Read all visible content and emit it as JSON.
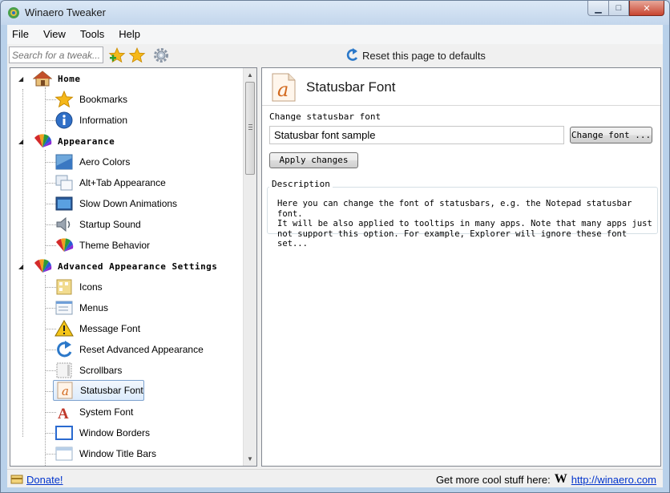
{
  "window": {
    "title": "Winaero Tweaker",
    "controls": {
      "minimize": "▁",
      "maximize": "□",
      "close": "✕"
    }
  },
  "menu": [
    "File",
    "View",
    "Tools",
    "Help"
  ],
  "toolbar": {
    "search_placeholder": "Search for a tweak...",
    "reset_label": "Reset this page to defaults"
  },
  "tree": {
    "home": {
      "label": "Home",
      "items": [
        "Bookmarks",
        "Information"
      ]
    },
    "appearance": {
      "label": "Appearance",
      "items": [
        "Aero Colors",
        "Alt+Tab Appearance",
        "Slow Down Animations",
        "Startup Sound",
        "Theme Behavior"
      ]
    },
    "advanced": {
      "label": "Advanced Appearance Settings",
      "items": [
        "Icons",
        "Menus",
        "Message Font",
        "Reset Advanced Appearance",
        "Scrollbars",
        "Statusbar Font",
        "System Font",
        "Window Borders",
        "Window Title Bars"
      ]
    },
    "selected": "Statusbar Font"
  },
  "content": {
    "title": "Statusbar Font",
    "change_label": "Change statusbar font",
    "sample_text": "Statusbar font sample",
    "change_font_button": "Change font ...",
    "apply_button": "Apply changes",
    "description_label": "Description",
    "description_lines": [
      "Here you can change the font of statusbars, e.g. the Notepad statusbar font.",
      "It will be also applied to tooltips in many apps. Note that many apps just",
      "not support this option. For example, Explorer will ignore these font set..."
    ]
  },
  "status": {
    "donate": "Donate!",
    "cool": "Get more cool stuff here:",
    "url": "http://winaero.com",
    "logo_letter": "W"
  },
  "colors": {
    "accent": "#3366cc",
    "link": "#0033cc",
    "close": "#c8442f"
  }
}
